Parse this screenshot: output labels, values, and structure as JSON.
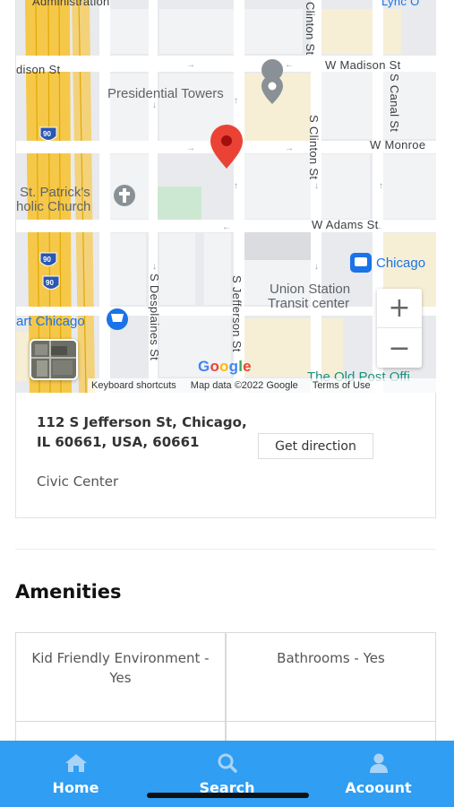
{
  "map": {
    "streets": {
      "madison_west": "dison St",
      "madison_east": "W Madison St",
      "monroe": "W Monroe",
      "adams": "W Adams St",
      "clinton_top": "Clinton St",
      "clinton_mid": "S Clinton St",
      "canal": "S Canal St",
      "desplaines": "S Desplaines St",
      "jefferson": "S Jefferson St",
      "top_partial": "Administration",
      "top_right_partial": "Lync O"
    },
    "pois": {
      "presidential_towers": "Presidential Towers",
      "st_patricks_line1": "St. Patrick's",
      "st_patricks_line2": "holic Church",
      "art_chicago": "art Chicago",
      "chicago_transit": "Chicago",
      "union_station_line1": "Union Station",
      "union_station_line2": "Transit center",
      "old_post_office": "The Old Post Offi"
    },
    "highway_shields": [
      "90",
      "90",
      "90"
    ],
    "zoom_in_label": "+",
    "zoom_out_label": "−",
    "google_logo": [
      "G",
      "o",
      "o",
      "g",
      "l",
      "e"
    ],
    "google_colors": [
      "#4285F4",
      "#EA4335",
      "#FBBC05",
      "#4285F4",
      "#34A853",
      "#EA4335"
    ],
    "attribution": {
      "keyboard": "Keyboard shortcuts",
      "map_data": "Map data ©2022 Google",
      "terms": "Terms of Use"
    },
    "pin_color": "#EA4335"
  },
  "location": {
    "address": "112 S Jefferson St, Chicago, IL 60661, USA, 60661",
    "neighborhood": "Civic Center",
    "direction_button": "Get direction"
  },
  "amenities": {
    "title": "Amenities",
    "items": [
      "Kid Friendly Environment - Yes",
      "Bathrooms - Yes",
      "",
      ""
    ]
  },
  "tabbar": {
    "color": "#2f9ef3",
    "tabs": [
      {
        "label": "Home",
        "icon": "home-icon"
      },
      {
        "label": "Search",
        "icon": "search-icon"
      },
      {
        "label": "Acoount",
        "icon": "user-icon"
      }
    ]
  }
}
